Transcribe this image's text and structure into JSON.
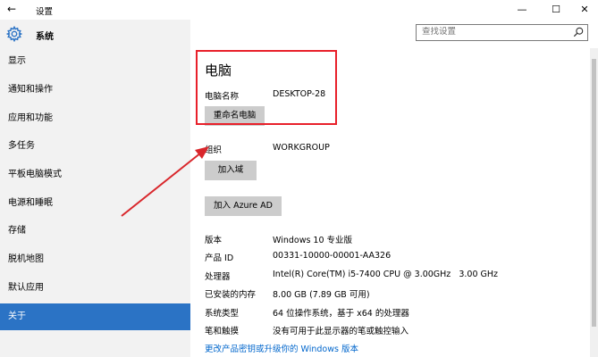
{
  "window": {
    "back_glyph": "←",
    "title": "设置",
    "minimize_glyph": "—",
    "maximize_glyph": "☐",
    "close_glyph": "✕"
  },
  "header": {
    "section_title": "系统",
    "search_placeholder": "查找设置"
  },
  "sidebar": {
    "items": [
      {
        "label": "显示"
      },
      {
        "label": "通知和操作"
      },
      {
        "label": "应用和功能"
      },
      {
        "label": "多任务"
      },
      {
        "label": "平板电脑模式"
      },
      {
        "label": "电源和睡眠"
      },
      {
        "label": "存储"
      },
      {
        "label": "脱机地图"
      },
      {
        "label": "默认应用"
      },
      {
        "label": "关于"
      }
    ],
    "selected_index": 9
  },
  "main": {
    "heading": "电脑",
    "pc_name_label": "电脑名称",
    "pc_name_value": "DESKTOP-28",
    "rename_button": "重命名电脑",
    "org_label": "组织",
    "org_value": "WORKGROUP",
    "join_domain_button": "加入域",
    "join_azure_button": "加入 Azure AD",
    "specs": [
      {
        "label": "版本",
        "value": "Windows 10 专业版"
      },
      {
        "label": "产品 ID",
        "value": "00331-10000-00001-AA326"
      },
      {
        "label": "处理器",
        "value": "Intel(R) Core(TM) i5-7400 CPU @ 3.00GHz   3.00 GHz"
      },
      {
        "label": "已安装的内存",
        "value": "8.00 GB (7.89 GB 可用)"
      },
      {
        "label": "系统类型",
        "value": "64 位操作系统，基于 x64 的处理器"
      },
      {
        "label": "笔和触摸",
        "value": "没有可用于此显示器的笔或触控输入"
      }
    ],
    "upgrade_link": "更改产品密钥或升级你的 Windows 版本"
  },
  "colors": {
    "accent": "#2b73c5",
    "highlight_box": "#e8202a",
    "arrow": "#d9262b",
    "link": "#0066cc",
    "button_bg": "#cccccc"
  },
  "icons": {
    "gear": "gear-icon",
    "search": "search-icon",
    "back": "back-arrow-icon"
  }
}
